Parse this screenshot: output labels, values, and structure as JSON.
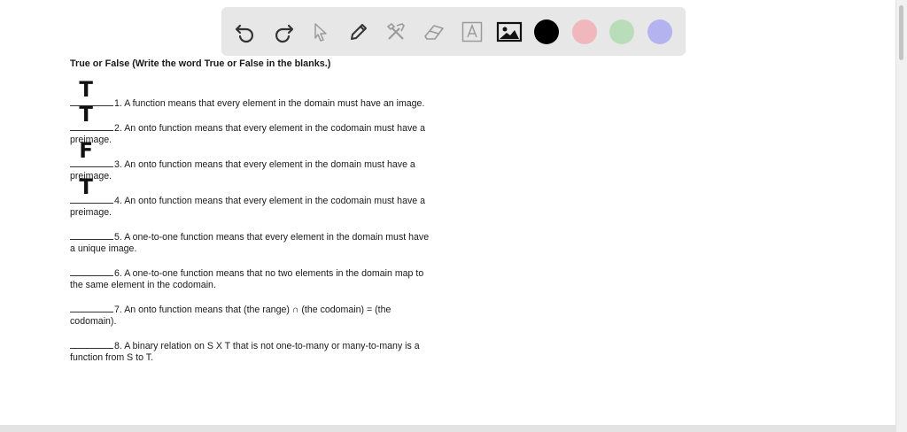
{
  "toolbar": {
    "tools": [
      "undo-icon",
      "redo-icon",
      "select-pointer-icon",
      "pen-icon",
      "tools-icon",
      "eraser-icon",
      "text-icon",
      "image-icon"
    ],
    "colors": [
      "#000000",
      "#f0b7bd",
      "#b9dcb9",
      "#b4b3ef"
    ]
  },
  "document": {
    "heading": "True or False (Write the word True or False in the blanks.)",
    "questions": [
      {
        "answer": "T",
        "line1": "1.  A function means that every element in the domain must have an image.",
        "line2": ""
      },
      {
        "answer": "T",
        "line1": "2.  An onto function means that every element in the codomain must have a",
        "line2": "preimage."
      },
      {
        "answer": "F",
        "line1": "3.  An onto function means that every element in the domain must have a",
        "line2": "preimage."
      },
      {
        "answer": "T",
        "line1": "4.  An onto function means that every element in the codomain must have a",
        "line2": "preimage."
      },
      {
        "answer": "",
        "line1": "5.  A one-to-one function means that every element in the domain must have",
        "line2": "a unique image."
      },
      {
        "answer": "",
        "line1": "6.  A one-to-one function means that no two elements in the domain map to",
        "line2": "the same element in the codomain."
      },
      {
        "answer": "",
        "line1": "7.  An onto function means that (the range) ∩ (the codomain) = (the",
        "line2": "codomain)."
      },
      {
        "answer": "",
        "line1": "8.  A binary relation on S X T that is not one-to-many or many-to-many is a",
        "line2": "function from S to T."
      }
    ]
  }
}
